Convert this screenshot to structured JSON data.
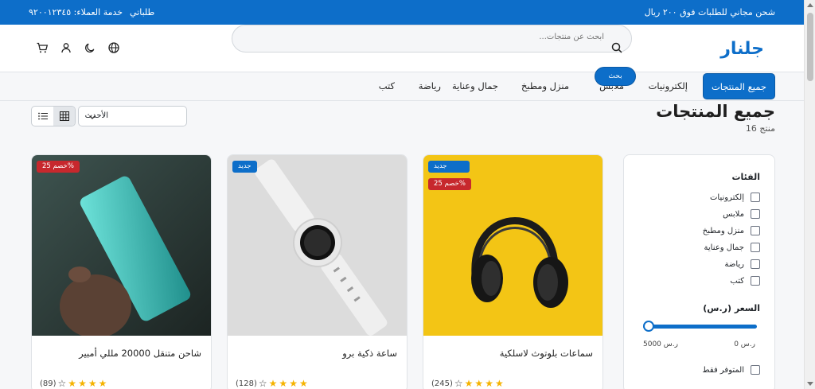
{
  "topbar": {
    "promo": "شحن مجاني للطلبات فوق ٢٠٠ ريال",
    "orders": "طلباتي",
    "support": "خدمة العملاء: ٩٢٠٠١٢٣٤٥"
  },
  "header": {
    "logo": "جلنار",
    "search_placeholder": "ابحث عن منتجات...",
    "search_button": "بحث",
    "icons": [
      "globe-icon",
      "moon-icon",
      "user-icon",
      "cart-icon"
    ]
  },
  "nav": {
    "categories": [
      "جميع المنتجات",
      "إلكترونيات",
      "ملابس",
      "منزل ومطبخ",
      "جمال وعناية",
      "رياضة",
      "كتب"
    ]
  },
  "page": {
    "title": "جميع المنتجات",
    "count": "16 منتج",
    "sort_value": "الأحدث"
  },
  "filters": {
    "categories_title": "الفئات",
    "categories": [
      "إلكترونيات",
      "ملابس",
      "منزل ومطبخ",
      "جمال وعناية",
      "رياضة",
      "كتب"
    ],
    "price_title": "السعر (ر.س)",
    "price_min": "0 ر.س",
    "price_max": "5000 ر.س",
    "in_stock": "المتوفر فقط"
  },
  "products": [
    {
      "name": "سماعات بلوتوث لاسلكية",
      "rating_count": "(245)",
      "badge_new": "جديد",
      "badge_sale": "خصم 25%"
    },
    {
      "name": "ساعة ذكية برو",
      "rating_count": "(128)",
      "badge_new": "جديد"
    },
    {
      "name": "شاحن متنقل 20000 مللي أمبير",
      "rating_count": "(89)",
      "badge_sale": "خصم 25%"
    }
  ],
  "colors": {
    "primary": "#0d6ec9",
    "sale": "#c7282d",
    "star": "#f5b301"
  }
}
